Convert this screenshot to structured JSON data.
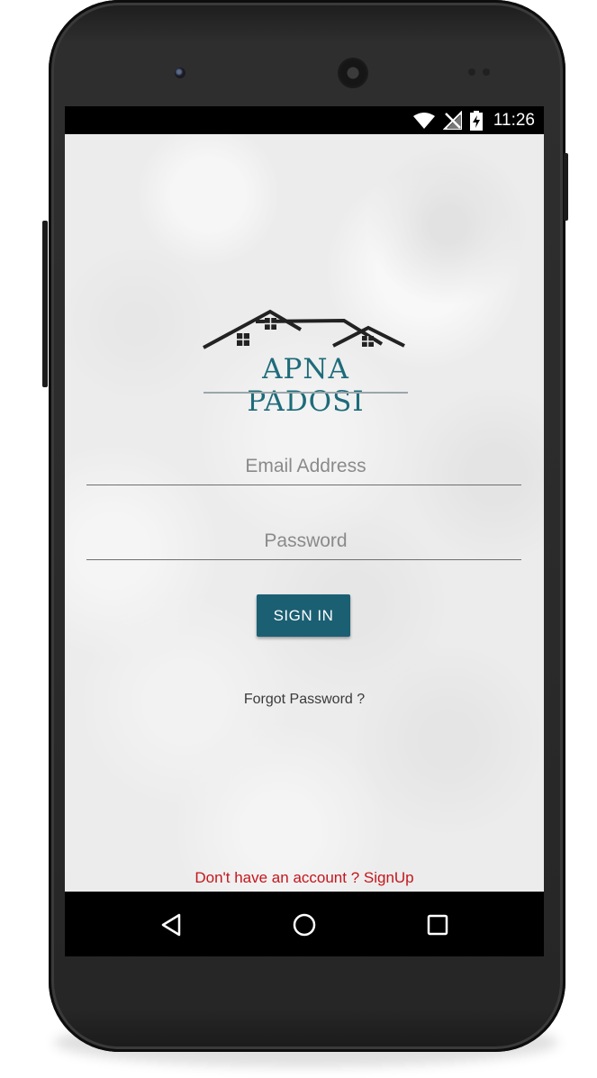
{
  "status_bar": {
    "time": "11:26",
    "icons": [
      "wifi-icon",
      "no-signal-icon",
      "battery-charging-icon"
    ]
  },
  "logo": {
    "brand_name": "APNA PADOSI",
    "icon": "house-roofs-icon",
    "color": "#1e6b7a"
  },
  "form": {
    "email_placeholder": "Email Address",
    "password_placeholder": "Password",
    "signin_label": "SIGN IN",
    "forgot_label": "Forgot Password ?",
    "signup_label": "Don't have an account ? SignUp"
  },
  "colors": {
    "button": "#1b5f73",
    "signup_text": "#c4161c"
  },
  "nav_bar": {
    "items": [
      "back-icon",
      "home-icon",
      "recents-icon"
    ]
  }
}
